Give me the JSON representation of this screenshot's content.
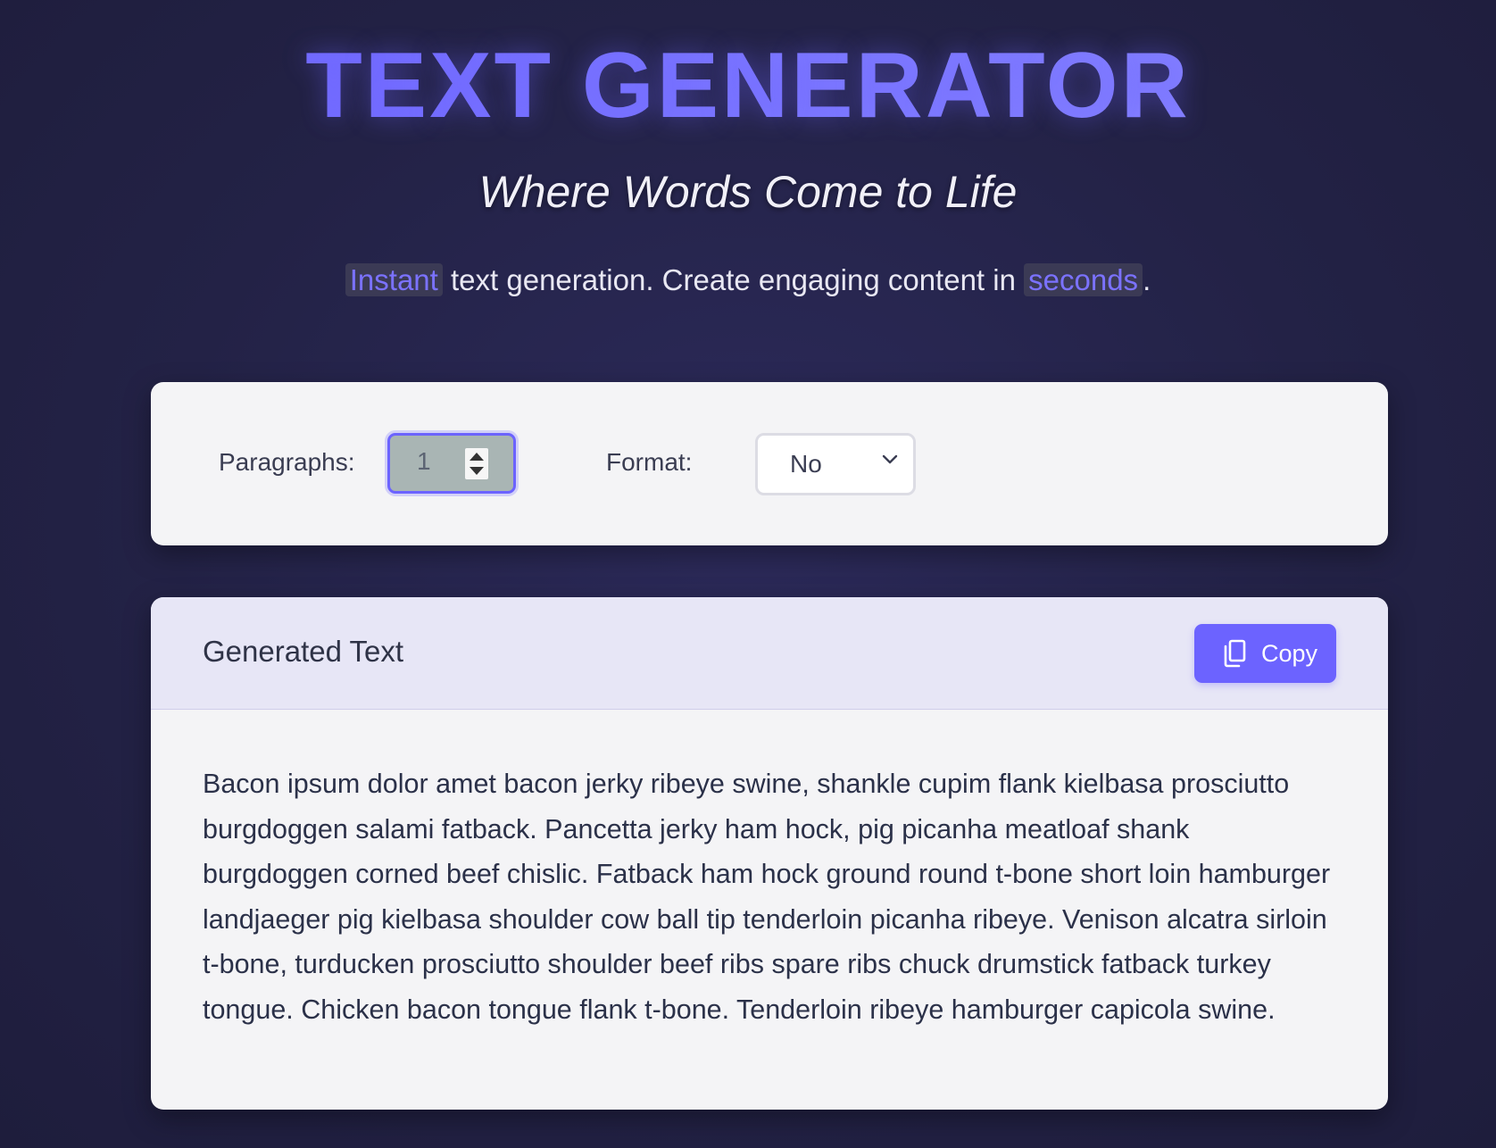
{
  "hero": {
    "title": "TEXT GENERATOR",
    "tagline": "Where Words Come to Life",
    "intro": {
      "highlight_1": "Instant",
      "middle": " text generation. Create engaging content in ",
      "highlight_2": "seconds",
      "end": "."
    }
  },
  "controls": {
    "paragraphs_label": "Paragraphs:",
    "paragraphs_value": "1",
    "format_label": "Format:",
    "format_value": "No"
  },
  "output": {
    "title": "Generated Text",
    "copy_label": "Copy",
    "text": "Bacon ipsum dolor amet bacon jerky ribeye swine, shankle cupim flank kielbasa prosciutto burgdoggen salami fatback. Pancetta jerky ham hock, pig picanha meatloaf shank burgdoggen corned beef chislic. Fatback ham hock ground round t-bone short loin hamburger landjaeger pig kielbasa shoulder cow ball tip tenderloin picanha ribeye. Venison alcatra sirloin t-bone, turducken prosciutto shoulder beef ribs spare ribs chuck drumstick fatback turkey tongue. Chicken bacon tongue flank t-bone. Tenderloin ribeye hamburger capicola swine."
  },
  "icons": {
    "copy": "copy-icon",
    "select": "chevron-down-icon",
    "stepper": "spinner-arrows-icon"
  },
  "colors": {
    "accent": "#6c63ff",
    "background": "#232246",
    "card": "#f4f4f6",
    "output_header": "#e7e6f6"
  }
}
